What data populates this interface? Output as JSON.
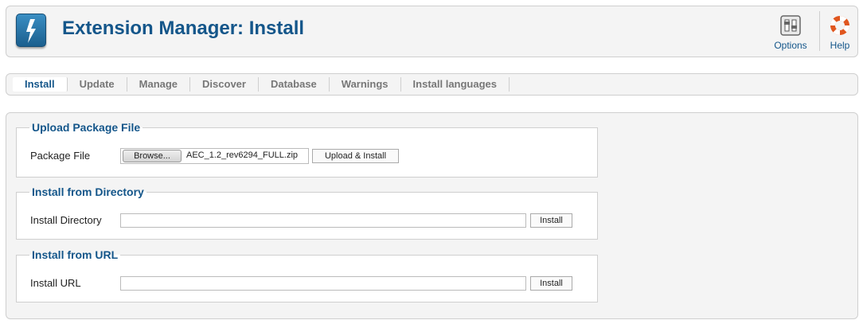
{
  "header": {
    "title": "Extension Manager: Install",
    "options_label": "Options",
    "help_label": "Help"
  },
  "tabs": [
    {
      "label": "Install",
      "active": true
    },
    {
      "label": "Update"
    },
    {
      "label": "Manage"
    },
    {
      "label": "Discover"
    },
    {
      "label": "Database"
    },
    {
      "label": "Warnings"
    },
    {
      "label": "Install languages"
    }
  ],
  "upload": {
    "legend": "Upload Package File",
    "label": "Package File",
    "browse_label": "Browse...",
    "file_value": "AEC_1.2_rev6294_FULL.zip",
    "button_label": "Upload & Install"
  },
  "directory": {
    "legend": "Install from Directory",
    "label": "Install Directory",
    "value": "",
    "button_label": "Install"
  },
  "url": {
    "legend": "Install from URL",
    "label": "Install URL",
    "value": "",
    "button_label": "Install"
  },
  "colors": {
    "accent": "#14568a",
    "panel_bg": "#f4f4f4",
    "border": "#cfcfcf"
  },
  "icons": [
    "extension-manager-logo-icon",
    "options-icon",
    "help-lifebuoy-icon"
  ]
}
